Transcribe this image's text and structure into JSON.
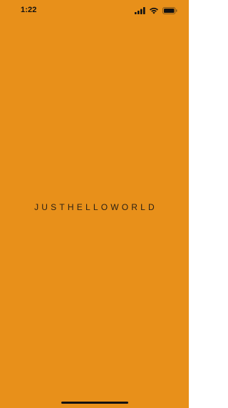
{
  "status_bar": {
    "time": "1:22"
  },
  "splash": {
    "wordmark": "JUSTHELLOWORLD"
  },
  "colors": {
    "background": "#e8901a",
    "wordmark": "#2b2014"
  },
  "icons": [
    "signal-icon",
    "wifi-icon",
    "battery-icon"
  ]
}
